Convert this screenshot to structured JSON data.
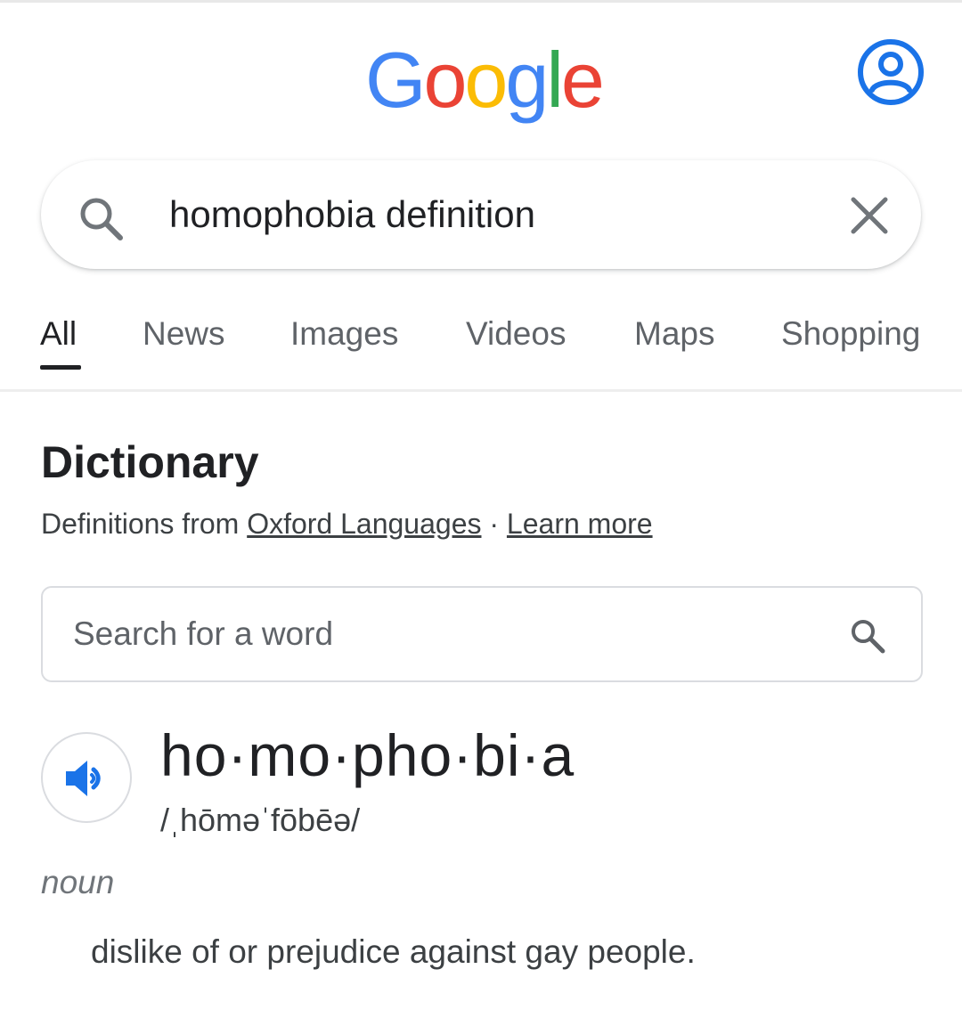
{
  "header": {
    "logo": {
      "letters": [
        "G",
        "o",
        "o",
        "g",
        "l",
        "e"
      ],
      "colors": [
        "#4285F4",
        "#EA4335",
        "#FBBC05",
        "#4285F4",
        "#34A853",
        "#EA4335"
      ]
    },
    "avatar_icon": "account-circle-icon",
    "avatar_color": "#1a73e8"
  },
  "search": {
    "query": "homophobia definition",
    "search_icon": "search-icon",
    "clear_icon": "close-icon"
  },
  "tabs": [
    {
      "label": "All",
      "active": true
    },
    {
      "label": "News",
      "active": false
    },
    {
      "label": "Images",
      "active": false
    },
    {
      "label": "Videos",
      "active": false
    },
    {
      "label": "Maps",
      "active": false
    },
    {
      "label": "Shopping",
      "active": false
    }
  ],
  "dictionary": {
    "title": "Dictionary",
    "subtitle_prefix": "Definitions from ",
    "source_link": "Oxford Languages",
    "separator": " · ",
    "learn_more": "Learn more",
    "word_search_placeholder": "Search for a word",
    "headword": "ho·mo·pho·bi·a",
    "phonetic": "/ˌhōməˈfōbēə/",
    "part_of_speech": "noun",
    "definition": "dislike of or prejudice against gay people.",
    "speaker_icon": "volume-icon",
    "accent_color": "#1a73e8"
  }
}
